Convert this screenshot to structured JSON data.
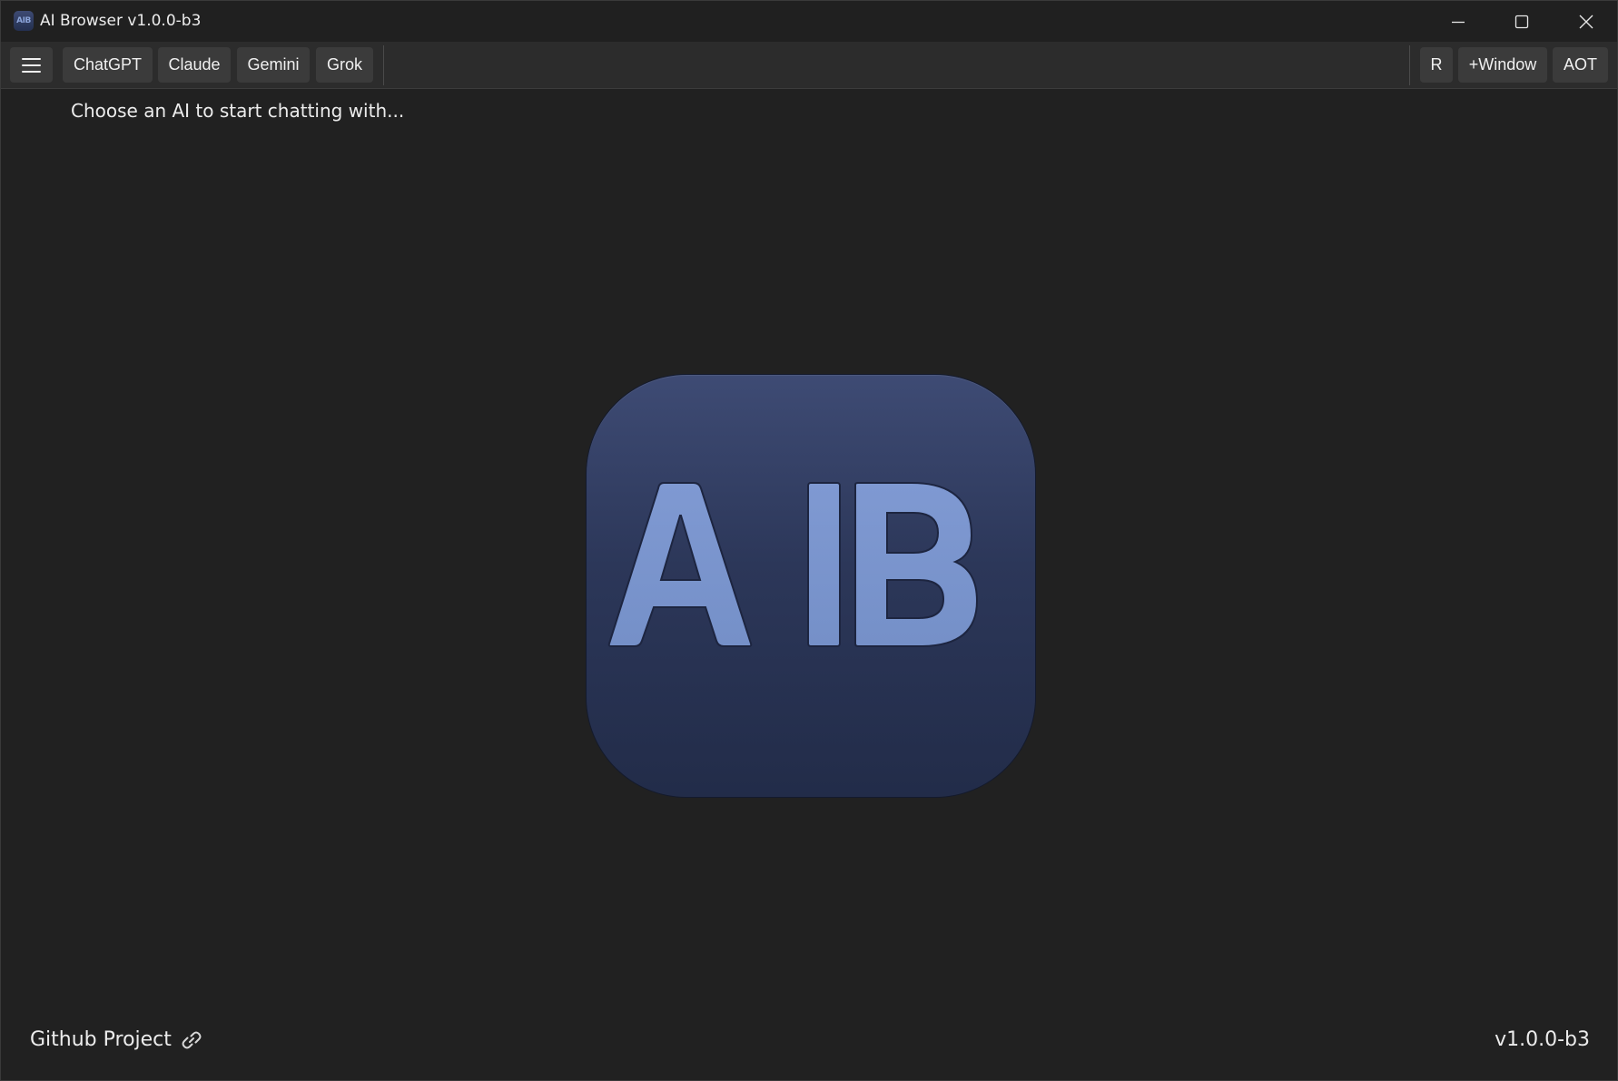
{
  "window": {
    "title": "AI Browser v1.0.0-b3",
    "app_icon_text": "AIB"
  },
  "toolbar": {
    "menu_icon": "hamburger-menu-icon",
    "ai_buttons": [
      {
        "label": "ChatGPT"
      },
      {
        "label": "Claude"
      },
      {
        "label": "Gemini"
      },
      {
        "label": "Grok"
      }
    ],
    "right_buttons": [
      {
        "label": "R"
      },
      {
        "label": "+Window"
      },
      {
        "label": "AOT"
      }
    ]
  },
  "main": {
    "prompt": "Choose an AI to start chatting with...",
    "logo_text": "AIB",
    "logo_colors": {
      "top": "#3e4b74",
      "bottom": "#222c49",
      "letters": "#7d97cf"
    }
  },
  "footer": {
    "github_label": "Github Project",
    "github_icon": "link-icon",
    "version": "v1.0.0-b3"
  }
}
